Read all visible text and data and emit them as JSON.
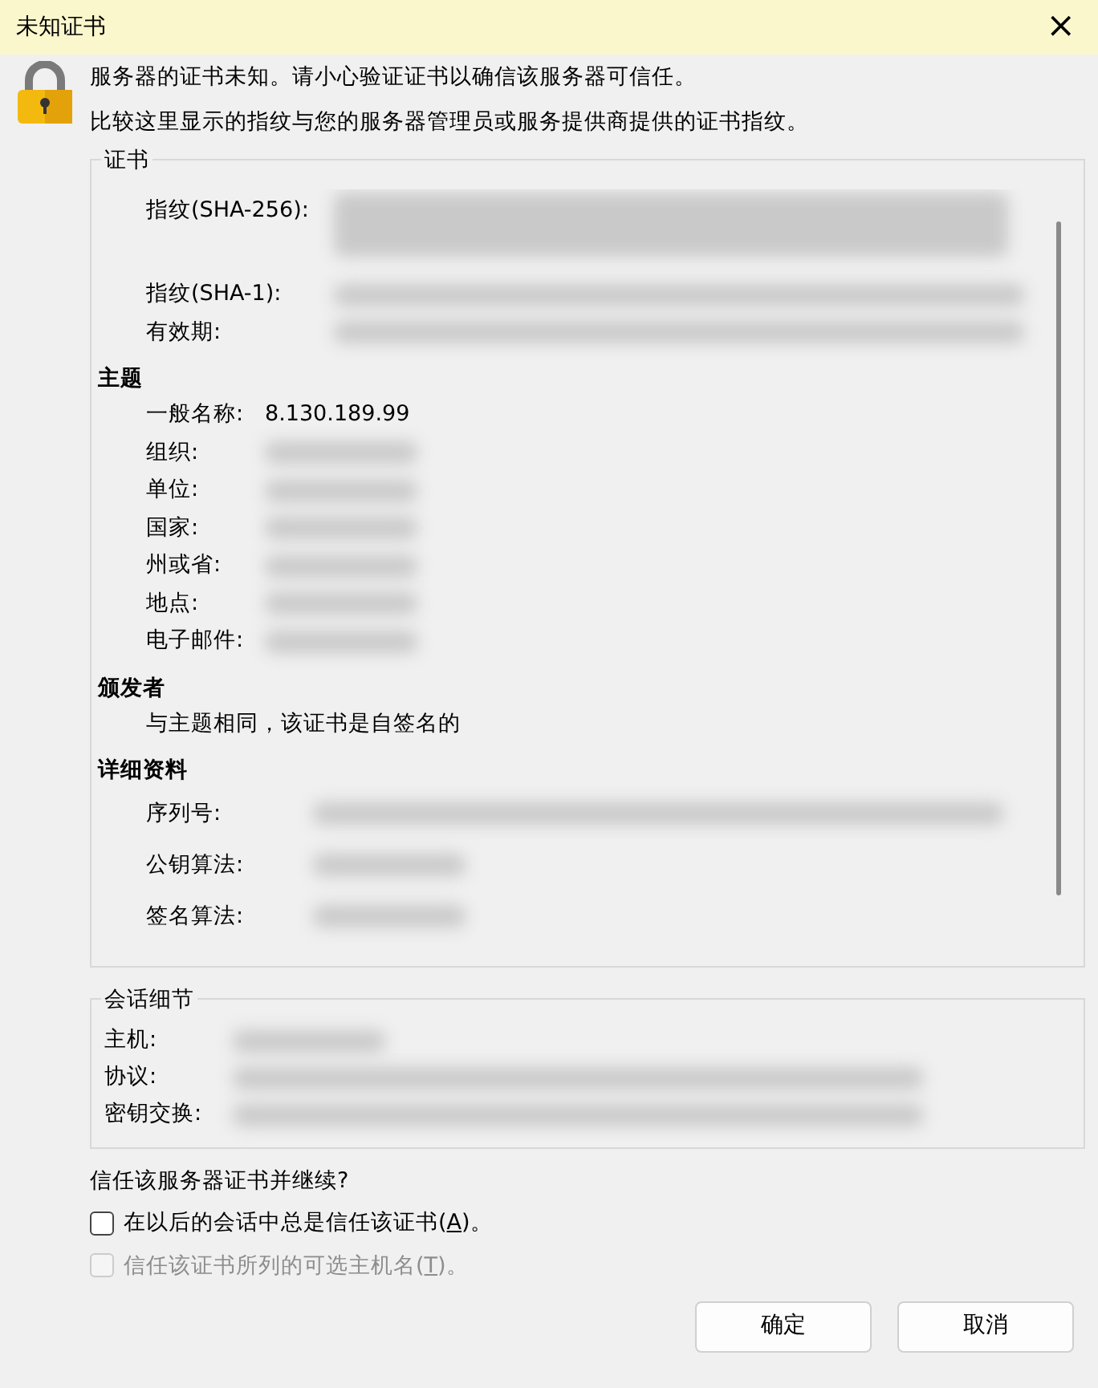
{
  "window": {
    "title": "未知证书",
    "close": "×"
  },
  "messages": [
    "服务器的证书未知。请小心验证证书以确信该服务器可信任。",
    "比较这里显示的指纹与您的服务器管理员或服务提供商提供的证书指纹。"
  ],
  "certificate": {
    "legend": "证书",
    "sections": [
      {
        "rows": [
          {
            "label": "指纹(SHA-256):",
            "kind": "redacted_block"
          },
          {
            "label": "指纹(SHA-1):",
            "kind": "redacted_long"
          },
          {
            "label": "有效期:",
            "kind": "redacted_long"
          }
        ]
      },
      {
        "heading": "主题",
        "rows": [
          {
            "label": "一般名称:",
            "kind": "text",
            "value": "8.130.189.99"
          },
          {
            "label": "组织:",
            "kind": "redacted_short"
          },
          {
            "label": "单位:",
            "kind": "redacted_short"
          },
          {
            "label": "国家:",
            "kind": "redacted_short"
          },
          {
            "label": "州或省:",
            "kind": "redacted_short"
          },
          {
            "label": "地点:",
            "kind": "redacted_short"
          },
          {
            "label": "电子邮件:",
            "kind": "redacted_short"
          }
        ]
      },
      {
        "heading": "颁发者",
        "rows": [
          {
            "label": "与主题相同，该证书是自签名的",
            "kind": "note"
          }
        ]
      },
      {
        "heading": "详细资料",
        "rows": [
          {
            "label": "序列号:",
            "kind": "redacted_long"
          },
          {
            "label": "公钥算法:",
            "kind": "redacted_short"
          },
          {
            "label": "签名算法:",
            "kind": "redacted_short"
          }
        ]
      }
    ]
  },
  "session": {
    "legend": "会话细节",
    "rows": [
      {
        "label": "主机:",
        "kind": "redacted_short"
      },
      {
        "label": "协议:",
        "kind": "redacted_long"
      },
      {
        "label": "密钥交换:",
        "kind": "redacted_long"
      }
    ]
  },
  "question": "信任该服务器证书并继续?",
  "options": [
    {
      "text_before": "在以后的会话中总是信任该证书(",
      "access_key": "A",
      "text_after": ")。",
      "checked": false,
      "disabled": false
    },
    {
      "text_before": "信任该证书所列的可选主机名(",
      "access_key": "T",
      "text_after": ")。",
      "checked": false,
      "disabled": true
    }
  ],
  "buttons": [
    "确定",
    "取消"
  ]
}
